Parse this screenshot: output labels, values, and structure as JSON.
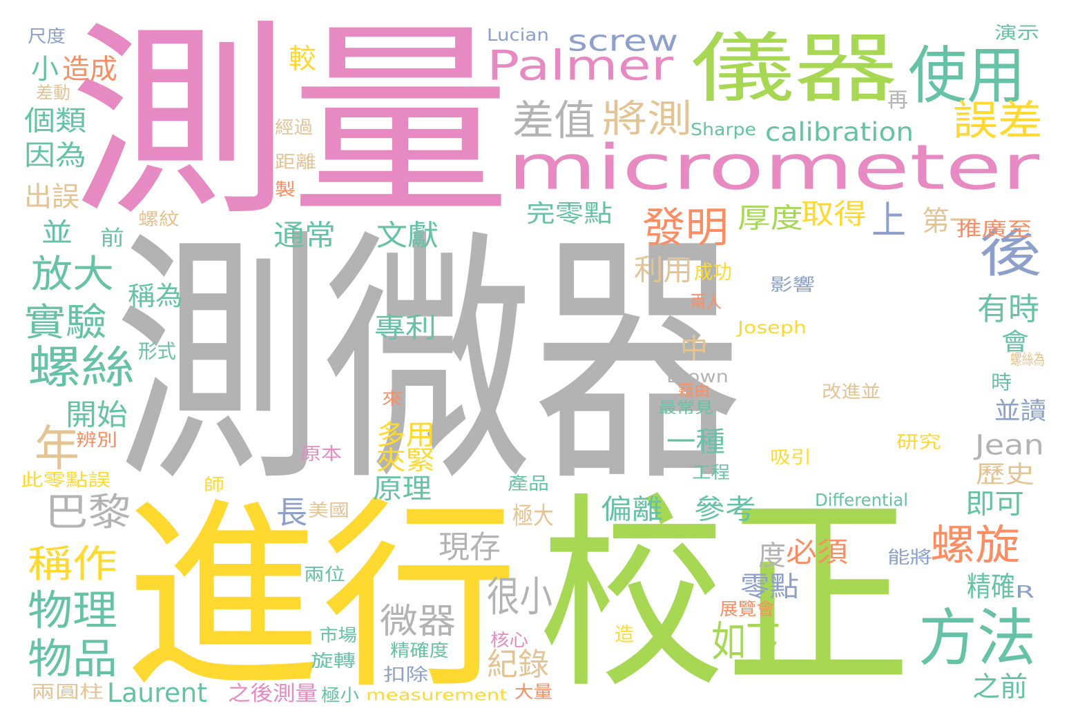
{
  "colors": {
    "pink": "#e78ac3",
    "gray": "#b3b3b3",
    "yellow": "#ffd92f",
    "green": "#a6d854",
    "teal": "#66c2a5",
    "orange": "#fc8d62",
    "blue": "#8da0cb",
    "tan": "#e5c494"
  },
  "words": [
    {
      "text": "測微器",
      "color": "gray"
    },
    {
      "text": "測量",
      "color": "pink"
    },
    {
      "text": "進行",
      "color": "yellow"
    },
    {
      "text": "校正",
      "color": "green"
    },
    {
      "text": "micrometer",
      "color": "pink"
    },
    {
      "text": "儀器",
      "color": "green"
    },
    {
      "text": "Palmer",
      "color": "pink"
    },
    {
      "text": "使用",
      "color": "teal"
    },
    {
      "text": "screw",
      "color": "blue"
    },
    {
      "text": "差值",
      "color": "gray"
    },
    {
      "text": "將測",
      "color": "tan"
    },
    {
      "text": "誤差",
      "color": "yellow"
    },
    {
      "text": "calibration",
      "color": "teal"
    },
    {
      "text": "發明",
      "color": "orange"
    },
    {
      "text": "厚度",
      "color": "green"
    },
    {
      "text": "取得",
      "color": "yellow"
    },
    {
      "text": "上",
      "color": "blue"
    },
    {
      "text": "第一",
      "color": "tan"
    },
    {
      "text": "完零點",
      "color": "teal"
    },
    {
      "text": "後",
      "color": "blue"
    },
    {
      "text": "通常",
      "color": "teal"
    },
    {
      "text": "文獻",
      "color": "teal"
    },
    {
      "text": "利用",
      "color": "tan"
    },
    {
      "text": "成功",
      "color": "yellow"
    },
    {
      "text": "影響",
      "color": "blue"
    },
    {
      "text": "兩人",
      "color": "orange"
    },
    {
      "text": "有時",
      "color": "teal"
    },
    {
      "text": "會",
      "color": "teal"
    },
    {
      "text": "Joseph",
      "color": "yellow"
    },
    {
      "text": "螺絲為",
      "color": "tan"
    },
    {
      "text": "Brown",
      "color": "gray"
    },
    {
      "text": "藉由",
      "color": "orange"
    },
    {
      "text": "最常見",
      "color": "teal"
    },
    {
      "text": "改進並",
      "color": "tan"
    },
    {
      "text": "時",
      "color": "teal"
    },
    {
      "text": "並讀",
      "color": "blue"
    },
    {
      "text": "Jean",
      "color": "gray"
    },
    {
      "text": "歷史",
      "color": "tan"
    },
    {
      "text": "研究",
      "color": "yellow"
    },
    {
      "text": "吸引",
      "color": "yellow"
    },
    {
      "text": "工程",
      "color": "teal"
    },
    {
      "text": "產品",
      "color": "teal"
    },
    {
      "text": "Differential",
      "color": "teal"
    },
    {
      "text": "即可",
      "color": "teal"
    },
    {
      "text": "專利",
      "color": "teal"
    },
    {
      "text": "中",
      "color": "tan"
    },
    {
      "text": "一種",
      "color": "teal"
    },
    {
      "text": "多用",
      "color": "yellow"
    },
    {
      "text": "夾緊",
      "color": "yellow"
    },
    {
      "text": "原理",
      "color": "teal"
    },
    {
      "text": "偏離",
      "color": "teal"
    },
    {
      "text": "參考",
      "color": "teal"
    },
    {
      "text": "極大",
      "color": "tan"
    },
    {
      "text": "現存",
      "color": "gray"
    },
    {
      "text": "度",
      "color": "gray"
    },
    {
      "text": "必須",
      "color": "orange"
    },
    {
      "text": "螺旋",
      "color": "orange"
    },
    {
      "text": "零點",
      "color": "blue"
    },
    {
      "text": "精確",
      "color": "teal"
    },
    {
      "text": "R",
      "color": "blue"
    },
    {
      "text": "如下",
      "color": "green"
    },
    {
      "text": "方法",
      "color": "teal"
    },
    {
      "text": "微器",
      "color": "gray"
    },
    {
      "text": "很小",
      "color": "gray"
    },
    {
      "text": "紀錄",
      "color": "tan"
    },
    {
      "text": "Laurent",
      "color": "teal"
    },
    {
      "text": "之後測量",
      "color": "pink"
    },
    {
      "text": "極小",
      "color": "teal"
    },
    {
      "text": "measurement",
      "color": "yellow"
    },
    {
      "text": "大量",
      "color": "orange"
    },
    {
      "text": "之前",
      "color": "teal"
    },
    {
      "text": "扣除",
      "color": "blue"
    },
    {
      "text": "旋轉",
      "color": "teal"
    },
    {
      "text": "精確度",
      "color": "teal"
    },
    {
      "text": "市場",
      "color": "teal"
    },
    {
      "text": "核心",
      "color": "pink"
    },
    {
      "text": "造",
      "color": "yellow"
    },
    {
      "text": "展覽會",
      "color": "orange"
    },
    {
      "text": "能將",
      "color": "blue"
    },
    {
      "text": "兩位",
      "color": "teal"
    },
    {
      "text": "長",
      "color": "blue"
    },
    {
      "text": "美國",
      "color": "tan"
    },
    {
      "text": "師",
      "color": "yellow"
    },
    {
      "text": "原本",
      "color": "pink"
    },
    {
      "text": "來",
      "color": "orange"
    },
    {
      "text": "形式",
      "color": "teal"
    },
    {
      "text": "尺度",
      "color": "blue"
    },
    {
      "text": "Lucian",
      "color": "blue"
    },
    {
      "text": "演示",
      "color": "teal"
    },
    {
      "text": "較",
      "color": "yellow"
    },
    {
      "text": "小",
      "color": "teal"
    },
    {
      "text": "造成",
      "color": "orange"
    },
    {
      "text": "差動",
      "color": "tan"
    },
    {
      "text": "個類",
      "color": "teal"
    },
    {
      "text": "經過",
      "color": "tan"
    },
    {
      "text": "因為",
      "color": "teal"
    },
    {
      "text": "距離",
      "color": "tan"
    },
    {
      "text": "出誤",
      "color": "tan"
    },
    {
      "text": "製",
      "color": "orange"
    },
    {
      "text": "再",
      "color": "gray"
    },
    {
      "text": "Sharpe",
      "color": "teal"
    },
    {
      "text": "推廣至",
      "color": "orange"
    },
    {
      "text": "並",
      "color": "teal"
    },
    {
      "text": "前",
      "color": "teal"
    },
    {
      "text": "螺紋",
      "color": "tan"
    },
    {
      "text": "放大",
      "color": "teal"
    },
    {
      "text": "稱為",
      "color": "teal"
    },
    {
      "text": "實驗",
      "color": "teal"
    },
    {
      "text": "螺絲",
      "color": "teal"
    },
    {
      "text": "開始",
      "color": "teal"
    },
    {
      "text": "年",
      "color": "tan"
    },
    {
      "text": "辨別",
      "color": "orange"
    },
    {
      "text": "此零點誤",
      "color": "yellow"
    },
    {
      "text": "巴黎",
      "color": "gray"
    },
    {
      "text": "稱作",
      "color": "yellow"
    },
    {
      "text": "物理",
      "color": "teal"
    },
    {
      "text": "物品",
      "color": "teal"
    },
    {
      "text": "兩圓柱",
      "color": "tan"
    }
  ]
}
